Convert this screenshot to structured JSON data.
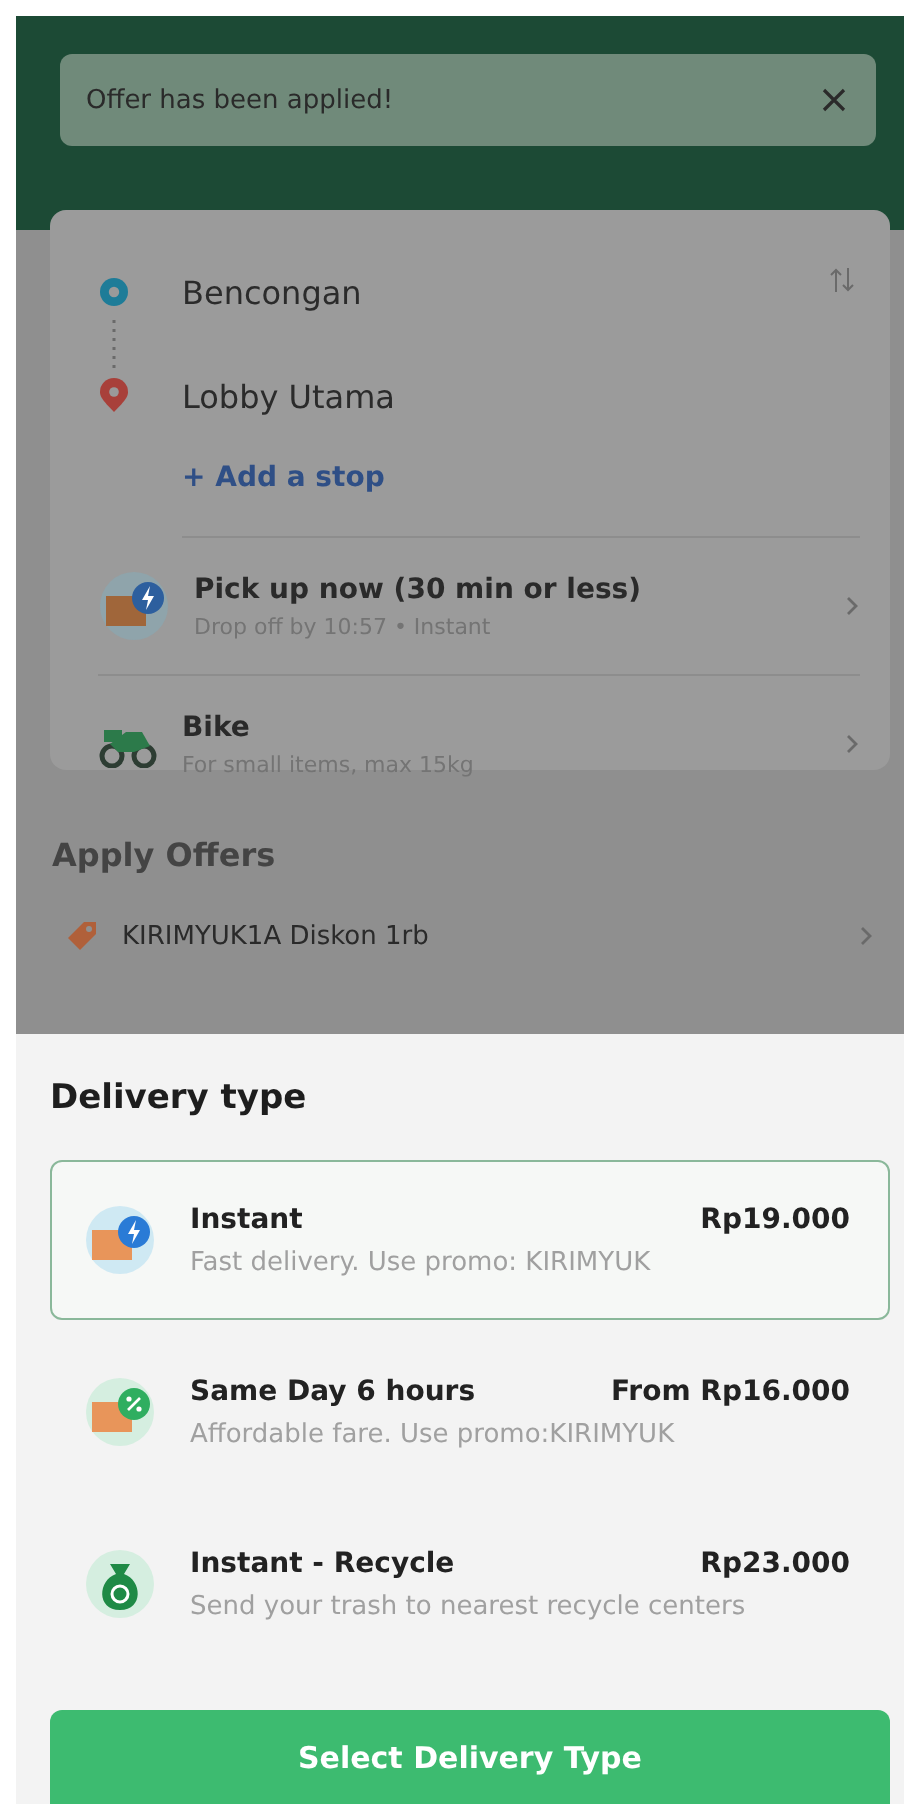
{
  "toast": {
    "text": "Offer has been applied!"
  },
  "route": {
    "stops": [
      {
        "name": "Bencongan",
        "kind": "origin"
      },
      {
        "name": "Lobby Utama",
        "kind": "destination"
      }
    ],
    "add_stop": "+ Add a stop"
  },
  "options": [
    {
      "kind": "schedule",
      "title": "Pick up now (30 min or less)",
      "subtitle": "Drop off by 10:57 • Instant"
    },
    {
      "kind": "vehicle",
      "title": "Bike",
      "subtitle": "For small items, max 15kg"
    }
  ],
  "offers": {
    "title": "Apply Offers",
    "items": [
      {
        "label": "KIRIMYUK1A Diskon 1rb"
      }
    ]
  },
  "sheet": {
    "title": "Delivery type",
    "types": [
      {
        "kind": "instant",
        "name": "Instant",
        "price": "Rp19.000",
        "description": "Fast delivery. Use promo: KIRIMYUK",
        "selected": true
      },
      {
        "kind": "sameday",
        "name": "Same Day 6 hours",
        "price": "From Rp16.000",
        "description": "Affordable fare. Use promo:KIRIMYUK",
        "selected": false
      },
      {
        "kind": "recycle",
        "name": "Instant - Recycle",
        "price": "Rp23.000",
        "description": "Send your trash to nearest recycle centers",
        "selected": false
      }
    ],
    "button": "Select Delivery Type"
  }
}
